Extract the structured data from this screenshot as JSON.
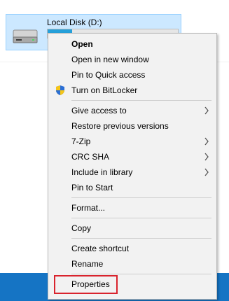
{
  "drive": {
    "name": "Local Disk (D:)",
    "usage_fraction": 0.19,
    "icon": "hard-drive-icon"
  },
  "context_menu": {
    "groups": [
      [
        {
          "label": "Open",
          "bold": true
        },
        {
          "label": "Open in new window"
        },
        {
          "label": "Pin to Quick access"
        },
        {
          "label": "Turn on BitLocker",
          "icon": "uac-shield-icon"
        }
      ],
      [
        {
          "label": "Give access to",
          "submenu": true
        },
        {
          "label": "Restore previous versions"
        },
        {
          "label": "7-Zip",
          "submenu": true
        },
        {
          "label": "CRC SHA",
          "submenu": true
        },
        {
          "label": "Include in library",
          "submenu": true
        },
        {
          "label": "Pin to Start"
        }
      ],
      [
        {
          "label": "Format..."
        }
      ],
      [
        {
          "label": "Copy"
        }
      ],
      [
        {
          "label": "Create shortcut"
        },
        {
          "label": "Rename"
        }
      ],
      [
        {
          "label": "Properties",
          "highlighted": true
        }
      ]
    ]
  },
  "colors": {
    "taskbar": "#1574c4",
    "selection_tile": "#cce8ff",
    "menu_background": "#f2f2f2",
    "highlight_outline": "#d9232d"
  }
}
